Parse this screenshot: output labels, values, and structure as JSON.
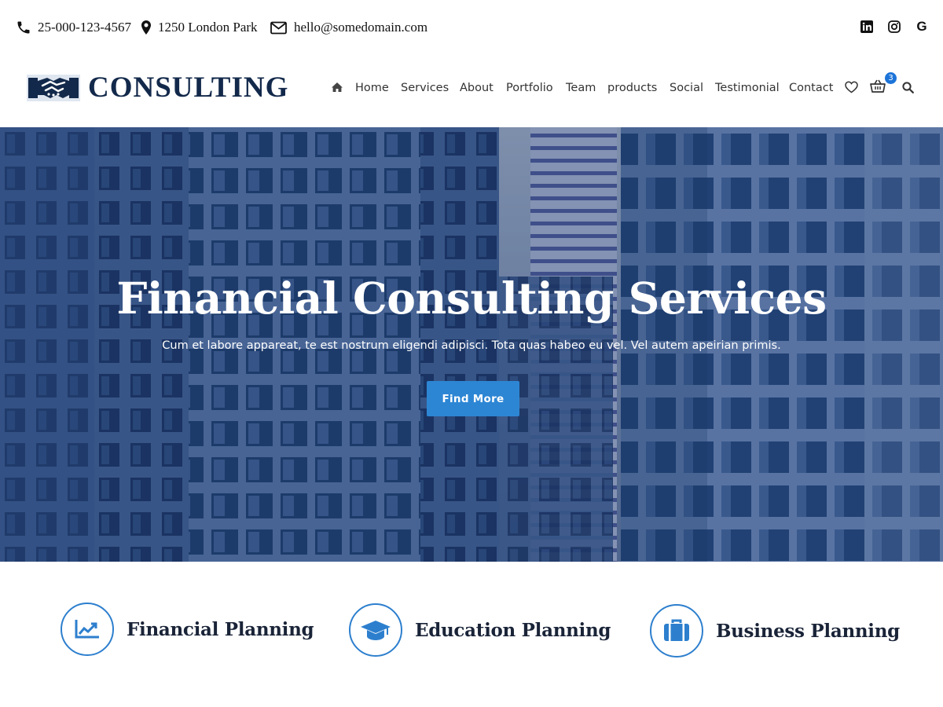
{
  "topbar": {
    "phone": "25-000-123-4567",
    "address": "1250 London Park",
    "email": "hello@somedomain.com",
    "social": [
      "linkedin-icon",
      "instagram-icon",
      "google-icon"
    ],
    "google_letter": "G"
  },
  "header": {
    "logo_text": "CONSULTING",
    "nav": [
      "Home",
      "Services",
      "About",
      "Portfolio",
      "Team",
      "products",
      "Social",
      "Testimonial",
      "Contact"
    ],
    "cart_count": "3"
  },
  "hero": {
    "title": "Financial Consulting Services",
    "subtitle": "Cum et labore appareat, te est nostrum eligendi adipisci. Tota quas habeo eu vel. Vel autem apeirian primis.",
    "button_label": "Find More"
  },
  "features": [
    {
      "title": "Financial Planning",
      "icon": "chart-line-icon"
    },
    {
      "title": "Education Planning",
      "icon": "graduation-cap-icon"
    },
    {
      "title": "Business Planning",
      "icon": "briefcase-icon"
    }
  ],
  "colors": {
    "accent": "#2d86d4",
    "logo": "#13294b",
    "badge": "#1d74d8"
  }
}
